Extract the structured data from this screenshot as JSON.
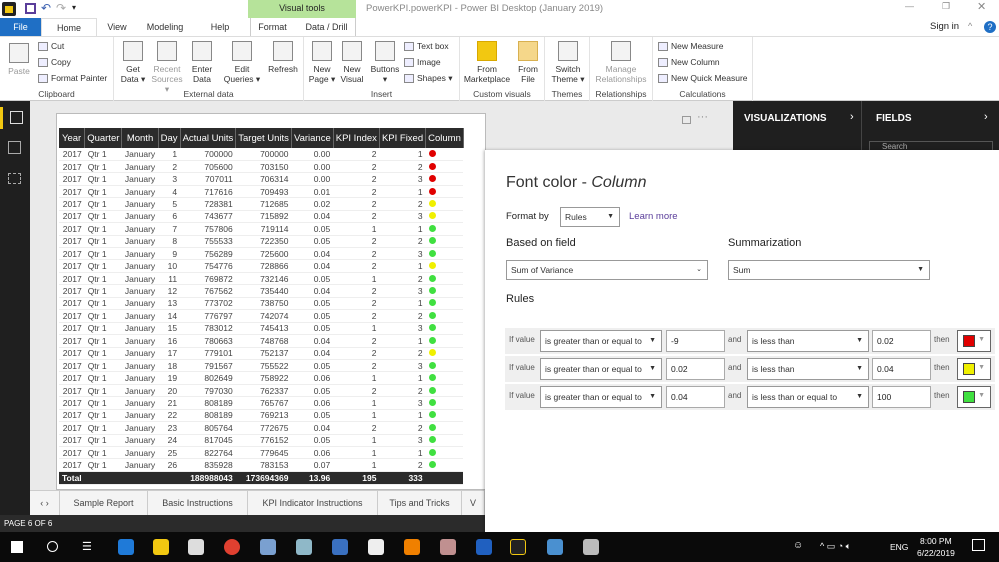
{
  "window": {
    "title": "PowerKPI.powerKPI - Power BI Desktop (January 2019)",
    "sign_in": "Sign in",
    "contextual_group": "Visual tools"
  },
  "tabs": [
    "File",
    "Home",
    "View",
    "Modeling",
    "Help",
    "Format",
    "Data / Drill"
  ],
  "ribbon": {
    "clipboard": {
      "label": "Clipboard",
      "paste": "Paste",
      "cut": "Cut",
      "copy": "Copy",
      "format_painter": "Format Painter"
    },
    "external_data": {
      "label": "External data",
      "get_data": "Get Data ▾",
      "recent_sources": "Recent Sources ▾",
      "enter_data": "Enter Data",
      "edit_queries": "Edit Queries ▾",
      "refresh": "Refresh"
    },
    "insert": {
      "label": "Insert",
      "new_page": "New Page ▾",
      "new_visual": "New Visual",
      "buttons": "Buttons ▾",
      "text_box": "Text box",
      "image": "Image",
      "shapes": "Shapes ▾"
    },
    "custom_visuals": {
      "label": "Custom visuals",
      "from_marketplace": "From Marketplace",
      "from_file": "From File"
    },
    "themes": {
      "label": "Themes",
      "switch_theme": "Switch Theme ▾"
    },
    "relationships": {
      "label": "Relationships",
      "manage": "Manage Relationships"
    },
    "calculations": {
      "label": "Calculations",
      "new_measure": "New Measure",
      "new_column": "New Column",
      "new_quick_measure": "New Quick Measure"
    }
  },
  "panes": {
    "visualizations": "VISUALIZATIONS",
    "fields": "FIELDS",
    "search_placeholder": "Search"
  },
  "table": {
    "columns": [
      "Year",
      "Quarter",
      "Month",
      "Day",
      "Actual Units",
      "Target Units",
      "Variance",
      "KPI Index",
      "KPI Fixed",
      "Column"
    ],
    "rows": [
      [
        "2017",
        "Qtr 1",
        "January",
        "1",
        "700000",
        "700000",
        "0.00",
        "2",
        "1",
        "red"
      ],
      [
        "2017",
        "Qtr 1",
        "January",
        "2",
        "705600",
        "703150",
        "0.00",
        "2",
        "2",
        "red"
      ],
      [
        "2017",
        "Qtr 1",
        "January",
        "3",
        "707011",
        "706314",
        "0.00",
        "2",
        "3",
        "red"
      ],
      [
        "2017",
        "Qtr 1",
        "January",
        "4",
        "717616",
        "709493",
        "0.01",
        "2",
        "1",
        "red"
      ],
      [
        "2017",
        "Qtr 1",
        "January",
        "5",
        "728381",
        "712685",
        "0.02",
        "2",
        "2",
        "yellow"
      ],
      [
        "2017",
        "Qtr 1",
        "January",
        "6",
        "743677",
        "715892",
        "0.04",
        "2",
        "3",
        "yellow"
      ],
      [
        "2017",
        "Qtr 1",
        "January",
        "7",
        "757806",
        "719114",
        "0.05",
        "1",
        "1",
        "green"
      ],
      [
        "2017",
        "Qtr 1",
        "January",
        "8",
        "755533",
        "722350",
        "0.05",
        "2",
        "2",
        "green"
      ],
      [
        "2017",
        "Qtr 1",
        "January",
        "9",
        "756289",
        "725600",
        "0.04",
        "2",
        "3",
        "green"
      ],
      [
        "2017",
        "Qtr 1",
        "January",
        "10",
        "754776",
        "728866",
        "0.04",
        "2",
        "1",
        "yellow"
      ],
      [
        "2017",
        "Qtr 1",
        "January",
        "11",
        "769872",
        "732146",
        "0.05",
        "1",
        "2",
        "green"
      ],
      [
        "2017",
        "Qtr 1",
        "January",
        "12",
        "767562",
        "735440",
        "0.04",
        "2",
        "3",
        "green"
      ],
      [
        "2017",
        "Qtr 1",
        "January",
        "13",
        "773702",
        "738750",
        "0.05",
        "2",
        "1",
        "green"
      ],
      [
        "2017",
        "Qtr 1",
        "January",
        "14",
        "776797",
        "742074",
        "0.05",
        "2",
        "2",
        "green"
      ],
      [
        "2017",
        "Qtr 1",
        "January",
        "15",
        "783012",
        "745413",
        "0.05",
        "1",
        "3",
        "green"
      ],
      [
        "2017",
        "Qtr 1",
        "January",
        "16",
        "780663",
        "748768",
        "0.04",
        "2",
        "1",
        "green"
      ],
      [
        "2017",
        "Qtr 1",
        "January",
        "17",
        "779101",
        "752137",
        "0.04",
        "2",
        "2",
        "yellow"
      ],
      [
        "2017",
        "Qtr 1",
        "January",
        "18",
        "791567",
        "755522",
        "0.05",
        "2",
        "3",
        "green"
      ],
      [
        "2017",
        "Qtr 1",
        "January",
        "19",
        "802649",
        "758922",
        "0.06",
        "1",
        "1",
        "green"
      ],
      [
        "2017",
        "Qtr 1",
        "January",
        "20",
        "797030",
        "762337",
        "0.05",
        "2",
        "2",
        "green"
      ],
      [
        "2017",
        "Qtr 1",
        "January",
        "21",
        "808189",
        "765767",
        "0.06",
        "1",
        "3",
        "green"
      ],
      [
        "2017",
        "Qtr 1",
        "January",
        "22",
        "808189",
        "769213",
        "0.05",
        "1",
        "1",
        "green"
      ],
      [
        "2017",
        "Qtr 1",
        "January",
        "23",
        "805764",
        "772675",
        "0.04",
        "2",
        "2",
        "green"
      ],
      [
        "2017",
        "Qtr 1",
        "January",
        "24",
        "817045",
        "776152",
        "0.05",
        "1",
        "3",
        "green"
      ],
      [
        "2017",
        "Qtr 1",
        "January",
        "25",
        "822764",
        "779645",
        "0.06",
        "1",
        "1",
        "green"
      ],
      [
        "2017",
        "Qtr 1",
        "January",
        "26",
        "835928",
        "783153",
        "0.07",
        "1",
        "2",
        "green"
      ]
    ],
    "total": [
      "Total",
      "",
      "",
      "",
      "188988043",
      "173694369",
      "13.96",
      "195",
      "333",
      ""
    ]
  },
  "dot_colors": {
    "red": "#e00000",
    "yellow": "#f0f000",
    "green": "#40e040"
  },
  "page_tabs": [
    "Sample Report",
    "Basic Instructions",
    "KPI Indicator Instructions",
    "Tips and Tricks",
    "V"
  ],
  "status": "PAGE 6 OF 6",
  "dialog": {
    "title": "Font color - ",
    "title_italic": "Column",
    "format_by_label": "Format by",
    "format_by_value": "Rules",
    "learn_more": "Learn more",
    "based_on_label": "Based on field",
    "based_on_value": "Sum of Variance",
    "summarization_label": "Summarization",
    "summarization_value": "Sum",
    "rules_label": "Rules",
    "rules": [
      {
        "if": "If value",
        "op1": "is greater than or equal to",
        "v1": "-9",
        "and": "and",
        "op2": "is less than",
        "v2": "0.02",
        "then": "then",
        "color": "#e00000"
      },
      {
        "if": "If value",
        "op1": "is greater than or equal to",
        "v1": "0.02",
        "and": "and",
        "op2": "is less than",
        "v2": "0.04",
        "then": "then",
        "color": "#f0f000"
      },
      {
        "if": "If value",
        "op1": "is greater than or equal to",
        "v1": "0.04",
        "and": "and",
        "op2": "is less than or equal to",
        "v2": "100",
        "then": "then",
        "color": "#40e040"
      }
    ]
  },
  "taskbar": {
    "lang": "ENG",
    "time": "8:00 PM",
    "date": "6/22/2019"
  }
}
